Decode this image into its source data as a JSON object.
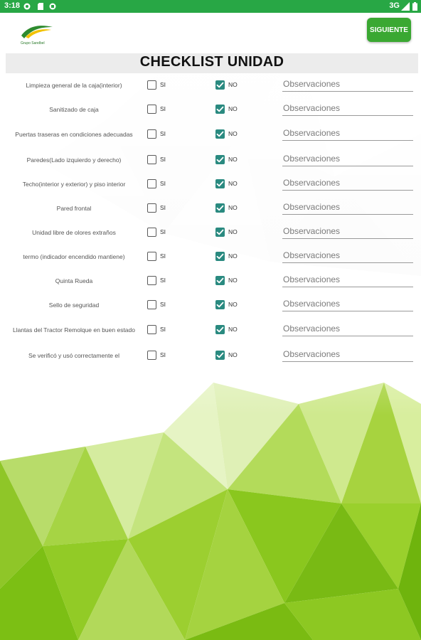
{
  "status_bar": {
    "time": "3:18",
    "network": "3G"
  },
  "app_bar": {
    "logo_text": "Grupo Sandbel",
    "next_button": "SIGUIENTE"
  },
  "title": "CHECKLIST UNIDAD",
  "options": {
    "yes": "SI",
    "no": "NO"
  },
  "observations_placeholder": "Observaciones",
  "items": [
    {
      "label": "Limpieza general de la caja(interior)",
      "si": false,
      "no": true
    },
    {
      "label": "Sanitizado de caja",
      "si": false,
      "no": true
    },
    {
      "label": "Puertas traseras en condiciones adecuadas",
      "si": false,
      "no": true
    },
    {
      "label": "Paredes(Lado izquierdo y derecho)",
      "si": false,
      "no": true
    },
    {
      "label": "Techo(interior y exterior) y piso interior",
      "si": false,
      "no": true
    },
    {
      "label": "Pared frontal",
      "si": false,
      "no": true
    },
    {
      "label": "Unidad libre de olores extraños",
      "si": false,
      "no": true
    },
    {
      "label": "termo (indicador encendido mantiene)",
      "si": false,
      "no": true
    },
    {
      "label": "Quinta Rueda",
      "si": false,
      "no": true
    },
    {
      "label": "Sello de seguridad",
      "si": false,
      "no": true
    },
    {
      "label": "Llantas del Tractor Remolque en buen estado",
      "si": false,
      "no": true
    },
    {
      "label": "Se verificó y usó correctamente el",
      "si": false,
      "no": true
    }
  ],
  "colors": {
    "status_bar": "#28a745",
    "button": "#3aa832",
    "checkbox_checked": "#2a8a80",
    "title_band": "#ececec"
  }
}
